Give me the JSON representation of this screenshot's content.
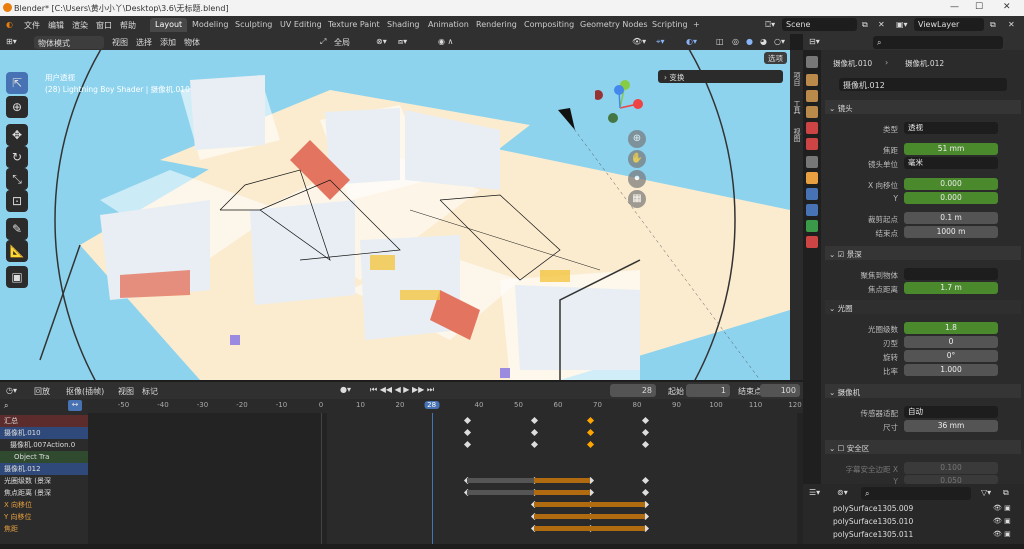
{
  "title": "Blender* [C:\\Users\\黄小小丫\\Desktop\\3.6\\无标题.blend]",
  "window_controls": [
    "—",
    "☐",
    "✕"
  ],
  "menu": [
    "文件",
    "编辑",
    "渲染",
    "窗口",
    "帮助"
  ],
  "workspaces": [
    "Layout",
    "Modeling",
    "Sculpting",
    "UV Editing",
    "Texture Paint",
    "Shading",
    "Animation",
    "Rendering",
    "Compositing",
    "Geometry Nodes",
    "Scripting",
    "+"
  ],
  "scene": "Scene",
  "view_layer": "ViewLayer",
  "viewport": {
    "mode": "物体模式",
    "menus": [
      "视图",
      "选择",
      "添加",
      "物体"
    ],
    "transform": "全局",
    "info1": "用户透视",
    "info2": "(28) Lightning Boy Shader | 摄像机.010",
    "options": "选项",
    "panel": "变换",
    "side_tabs": [
      "项目",
      "工具",
      "视图"
    ]
  },
  "timeline": {
    "editor": "回放",
    "keying": "抠像(插帧)",
    "menus": [
      "视图",
      "标记"
    ],
    "current_frame": "28",
    "start_label": "起始",
    "start": "1",
    "end_label": "结束点",
    "end": "100",
    "ticks": [
      "-50",
      "-40",
      "-30",
      "-20",
      "-10",
      "0",
      "10",
      "20",
      "28",
      "40",
      "50",
      "60",
      "70",
      "80",
      "90",
      "100",
      "110",
      "120"
    ],
    "channels": [
      "汇总",
      "摄像机.010",
      "摄像机.007Action.0",
      "Object Tra",
      "摄像机.012",
      "光圈级数 (景深",
      "焦点距离 (景深",
      "X 向移位",
      "Y 向移位",
      "焦距"
    ]
  },
  "props": {
    "breadcrumb1": "摄像机.010",
    "breadcrumb2": "摄像机.012",
    "data_name": "摄像机.012",
    "lens_section": "镜头",
    "fields": [
      {
        "label": "类型",
        "value": "透视"
      },
      {
        "label": "焦距",
        "value": "51 mm"
      },
      {
        "label": "镜头单位",
        "value": "毫米"
      },
      {
        "label": "X 向移位",
        "value": "0.000"
      },
      {
        "label": "Y",
        "value": "0.000"
      },
      {
        "label": "裁剪起点",
        "value": "0.1 m"
      },
      {
        "label": "结束点",
        "value": "1000 m"
      }
    ],
    "dof_section": "景深",
    "focus_obj_label": "聚焦到物体",
    "focus_dist_label": "焦点距离",
    "focus_dist": "1.7 m",
    "aperture_section": "光圈",
    "ap_fields": [
      {
        "label": "光圈级数",
        "value": "1.8"
      },
      {
        "label": "刃型",
        "value": "0"
      },
      {
        "label": "旋转",
        "value": "0°"
      },
      {
        "label": "比率",
        "value": "1.000"
      }
    ],
    "camera_section": "摄像机",
    "sensor_label": "传感器适配",
    "sensor": "自动",
    "size_label": "尺寸",
    "size": "36 mm",
    "safe_section": "安全区",
    "safe_label": "字幕安全边距 X",
    "safe_x": "0.100",
    "safe_y_label": "Y",
    "safe_y": "0.050"
  },
  "outliner": [
    "polySurface1305.009",
    "polySurface1305.010",
    "polySurface1305.011"
  ]
}
